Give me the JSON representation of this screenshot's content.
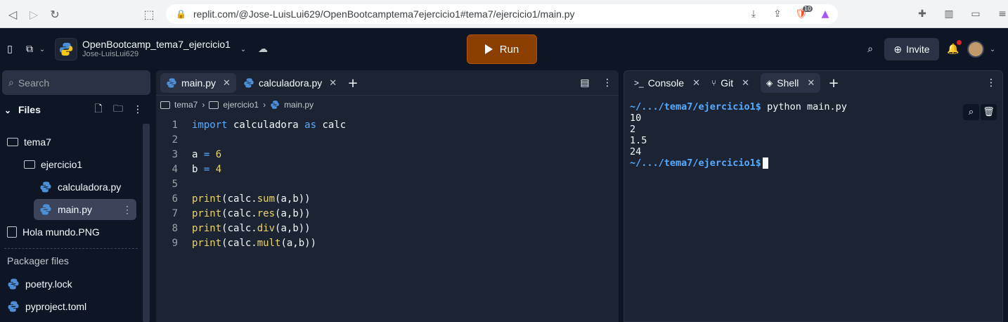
{
  "browser": {
    "url": "replit.com/@Jose-LuisLui629/OpenBootcamptema7ejercicio1#tema7/ejercicio1/main.py",
    "badge_count": "10"
  },
  "header": {
    "repl_name": "OpenBootcamp_tema7_ejercicio1",
    "owner": "Jose-LuisLui629",
    "run_label": "Run",
    "invite_label": "Invite",
    "run_color": "#8a3f00"
  },
  "sidebar": {
    "search_placeholder": "Search",
    "files_label": "Files",
    "tree": [
      {
        "label": "tema7",
        "type": "folder"
      },
      {
        "label": "ejercicio1",
        "type": "folder"
      },
      {
        "label": "calculadora.py",
        "type": "python"
      },
      {
        "label": "main.py",
        "type": "python",
        "selected": true
      },
      {
        "label": "Hola mundo.PNG",
        "type": "file"
      }
    ],
    "packager_label": "Packager files",
    "packager_files": [
      "poetry.lock",
      "pyproject.toml"
    ]
  },
  "editor": {
    "tabs": [
      {
        "label": "main.py",
        "active": true
      },
      {
        "label": "calculadora.py",
        "active": false
      }
    ],
    "breadcrumb": [
      "tema7",
      "ejercicio1",
      "main.py"
    ],
    "lines": [
      {
        "n": "1",
        "text": "import calculadora as calc"
      },
      {
        "n": "2",
        "text": ""
      },
      {
        "n": "3",
        "text": "a = 6"
      },
      {
        "n": "4",
        "text": "b = 4"
      },
      {
        "n": "5",
        "text": ""
      },
      {
        "n": "6",
        "text": "print(calc.sum(a,b))"
      },
      {
        "n": "7",
        "text": "print(calc.res(a,b))"
      },
      {
        "n": "8",
        "text": "print(calc.div(a,b))"
      },
      {
        "n": "9",
        "text": "print(calc.mult(a,b))"
      }
    ]
  },
  "console": {
    "tabs": [
      {
        "label": "Console",
        "active": false
      },
      {
        "label": "Git",
        "active": false
      },
      {
        "label": "Shell",
        "active": true
      }
    ],
    "prompt": "~/.../tema7/ejercicio1$",
    "command": " python main.py",
    "output": [
      "10",
      "2",
      "1.5",
      "24"
    ]
  }
}
